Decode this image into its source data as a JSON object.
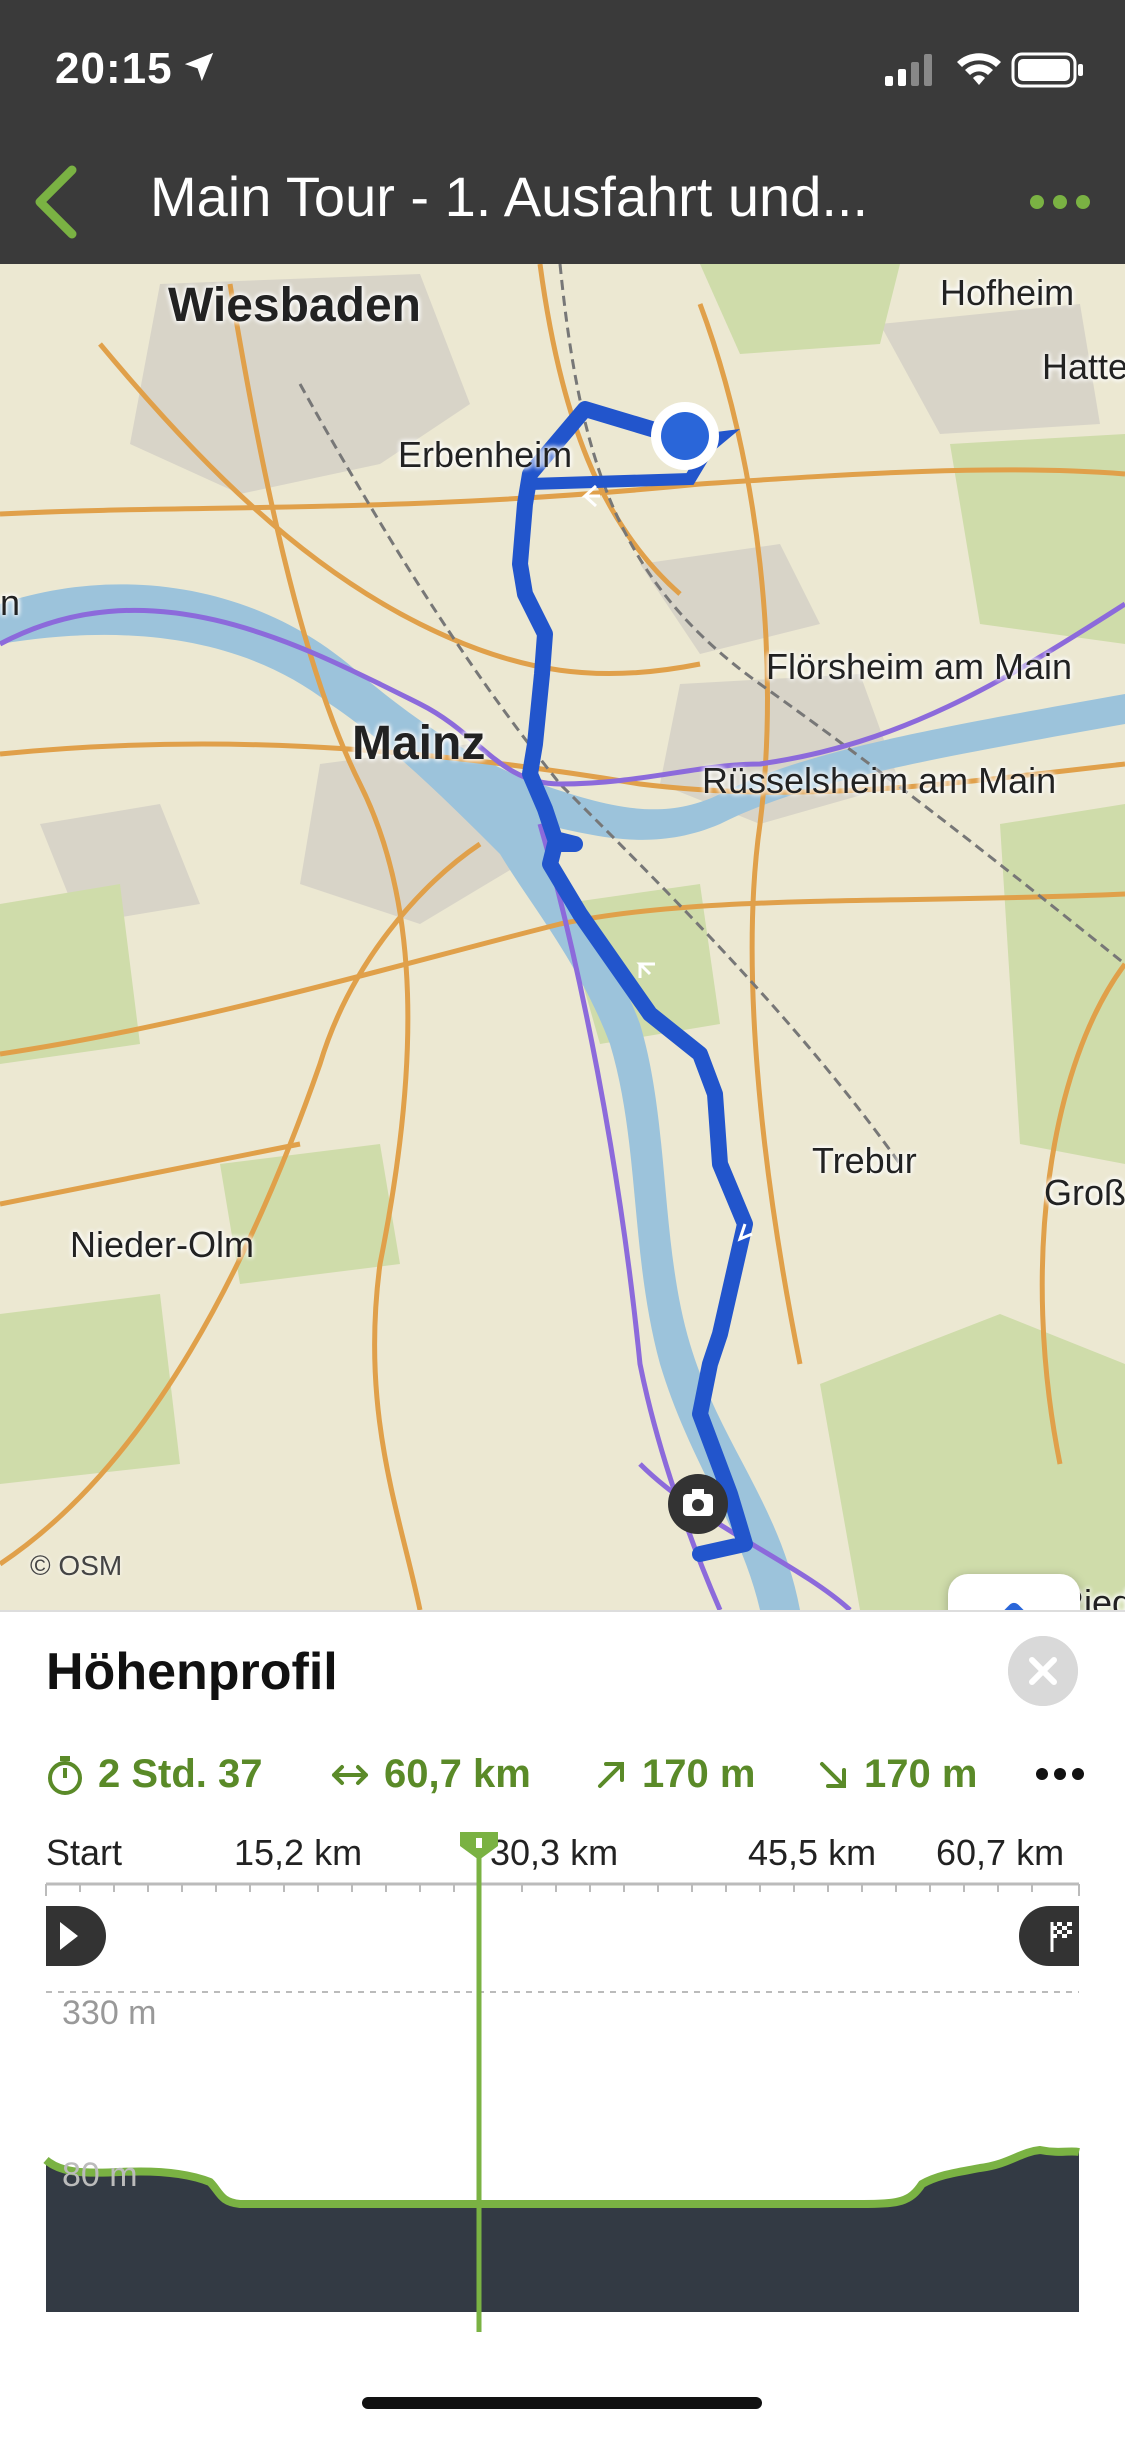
{
  "status_bar": {
    "time": "20:15"
  },
  "header": {
    "title": "Main Tour - 1. Ausfahrt und...",
    "back_icon": "chevron-left-icon",
    "more_icon": "more-dots-icon"
  },
  "map": {
    "labels": {
      "wiesbaden": "Wiesbaden",
      "hofheim": "Hofheim",
      "hatte": "Hatte",
      "erbenheim": "Erbenheim",
      "n": "n",
      "floersheim": "Flörsheim am Main",
      "mainz": "Mainz",
      "ruesselsheim": "Rüsselsheim am Main",
      "trebur": "Trebur",
      "gross": "Groß",
      "nieder_olm": "Nieder-Olm",
      "ried": "Ried"
    },
    "attribution": "© OSM",
    "controls": {
      "bike_icon": "bike-route-icon",
      "locate_icon": "navigation-arrow-icon"
    },
    "colors": {
      "route": "#2255cc",
      "river": "#9cc3db",
      "forest": "#cfdcaa",
      "roads": "#e0a04a",
      "rail": "#8c7adb"
    }
  },
  "elevation_panel": {
    "title": "Höhenprofil",
    "stats": {
      "duration": "2 Std. 37",
      "distance": "60,7 km",
      "ascent": "170 m",
      "descent": "170 m"
    },
    "axis": {
      "start": "Start",
      "km1": "15,2 km",
      "km2": "30,3 km",
      "km3": "45,5 km",
      "km4": "60,7 km"
    },
    "y_labels": {
      "top": "330 m",
      "bottom": "80 m"
    },
    "accent_color": "#7ab243"
  }
}
